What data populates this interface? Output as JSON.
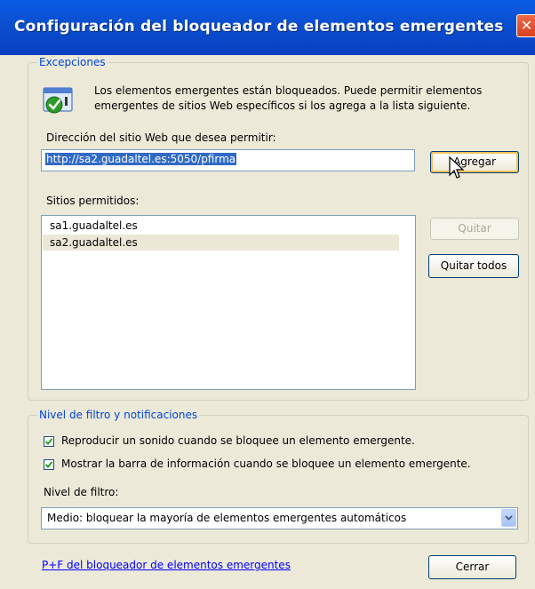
{
  "window": {
    "title": "Configuración del bloqueador de elementos emergentes"
  },
  "exceptions": {
    "legend": "Excepciones",
    "info_line1": "Los elementos emergentes están bloqueados.  Puede permitir elementos",
    "info_line2": "emergentes de sitios Web específicos si los agrega a la lista siguiente.",
    "address_label": "Dirección del sitio Web que desea permitir:",
    "address_value": "http://sa2.guadaltel.es:5050/pfirma",
    "add_button": "Agregar",
    "allowed_label": "Sitios permitidos:",
    "allowed_sites": [
      "sa1.guadaltel.es",
      "sa2.guadaltel.es"
    ],
    "remove_button": "Quitar",
    "remove_all_button": "Quitar todos"
  },
  "filter": {
    "legend": "Nivel de filtro y notificaciones",
    "sound_checkbox": "Reproducir un sonido cuando se bloquee un elemento emergente.",
    "sound_checked": true,
    "infobar_checkbox": "Mostrar la barra de información cuando se bloquee un elemento emergente.",
    "infobar_checked": true,
    "level_label": "Nivel de filtro:",
    "level_value": "Medio: bloquear la mayoría de elementos emergentes automáticos"
  },
  "footer": {
    "help_link": "P+F del bloqueador de elementos emergentes",
    "close_button": "Cerrar"
  },
  "colors": {
    "title_bar": "#0a4fd0",
    "link": "#0000ff",
    "selected_row": "#ebe8d6"
  },
  "icons": {
    "title_close": "close-icon",
    "info": "popup-blocker-check-icon",
    "cursor": "mouse-cursor-icon",
    "dropdown": "chevron-down-icon"
  }
}
